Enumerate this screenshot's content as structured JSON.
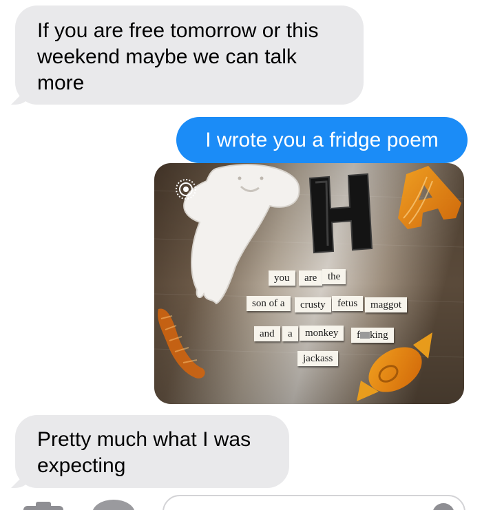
{
  "conversation": {
    "messages": [
      {
        "direction": "incoming",
        "text": "If you are free tomorrow or this weekend maybe we can talk more"
      },
      {
        "direction": "outgoing",
        "text": "I wrote you a fridge poem"
      },
      {
        "direction": "outgoing",
        "type": "photo"
      },
      {
        "direction": "incoming",
        "text": "Pretty much what I was expecting"
      }
    ]
  },
  "photo": {
    "live_icon": "live-photo-icon",
    "big_letter": "H",
    "magnets": {
      "row1": [
        "you",
        "are",
        "the"
      ],
      "row2": [
        "son of a",
        "crusty",
        "fetus",
        "maggot"
      ],
      "row3": [
        "and",
        "a",
        "monkey",
        "f",
        "king"
      ],
      "row4": [
        "jackass"
      ]
    }
  },
  "input_bar": {
    "camera_icon": "camera-icon",
    "apps_icon": "app-store-icon",
    "mic_icon": "microphone-icon"
  },
  "colors": {
    "incoming_bubble": "#e9e9eb",
    "outgoing_bubble": "#1b8cf7"
  }
}
